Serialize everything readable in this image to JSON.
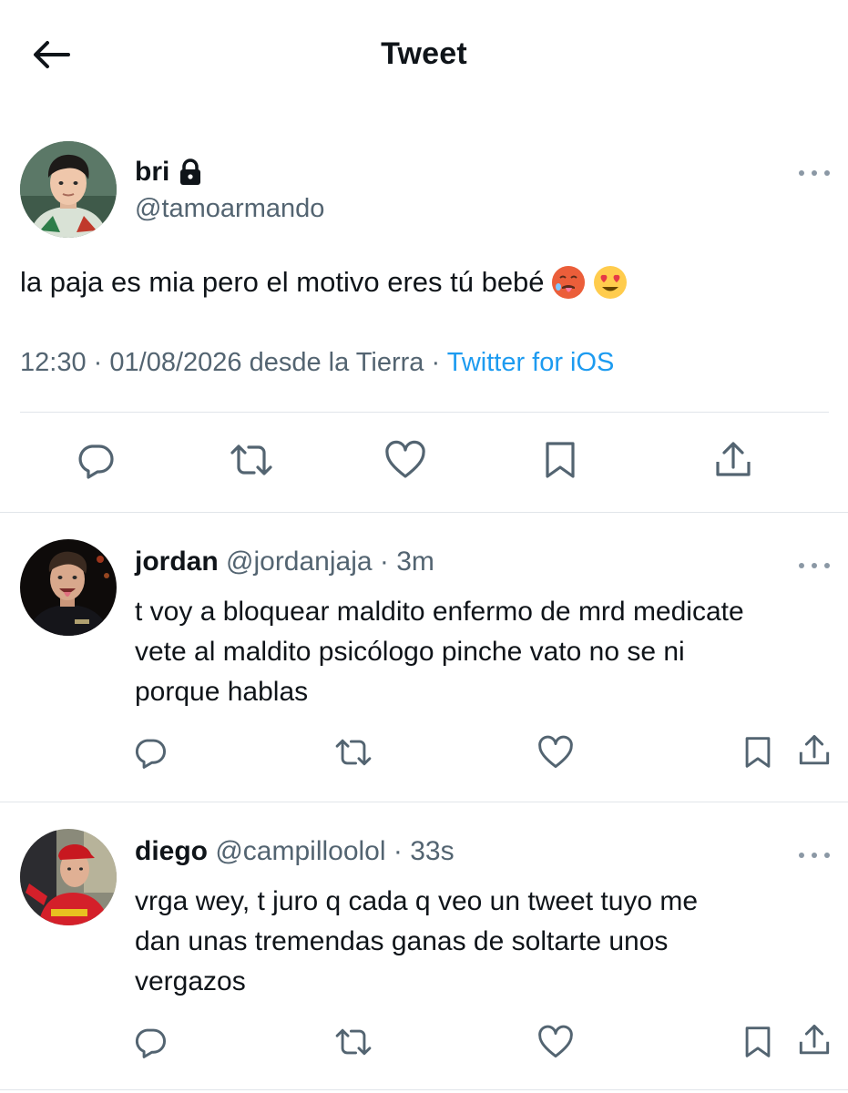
{
  "header": {
    "title": "Tweet",
    "back_icon": "arrow-left-icon"
  },
  "main_tweet": {
    "name": "bri",
    "handle": "@tamoarmando",
    "protected_icon": "lock-icon",
    "text": "la paja es mia pero el motivo eres tú bebé",
    "emojis": [
      "hot-face",
      "smiling-face-with-heart-eyes"
    ],
    "time": "12:30",
    "date": "01/08/2026",
    "location": "desde la Tierra",
    "separator": "·",
    "source": "Twitter for iOS",
    "actions": [
      "reply-icon",
      "retweet-icon",
      "like-icon",
      "bookmark-icon",
      "share-icon"
    ]
  },
  "replies": [
    {
      "name": "jordan",
      "handle": "@jordanjaja",
      "separator": "·",
      "time": "3m",
      "lines": [
        "t voy a bloquear maldito enfermo de mrd medicate",
        "vete al maldito psicólogo pinche vato no se ni",
        "porque hablas"
      ]
    },
    {
      "name": "diego",
      "handle": "@campilloolol",
      "separator": "·",
      "time": "33s",
      "lines": [
        "vrga wey, t juro q cada q veo un tweet tuyo me",
        "dan unas tremendas ganas de soltarte unos",
        "vergazos"
      ]
    }
  ],
  "colors": {
    "text": "#0f1419",
    "secondary": "#536471",
    "link": "#1d9bf0",
    "divider": "#e1e5ea"
  }
}
